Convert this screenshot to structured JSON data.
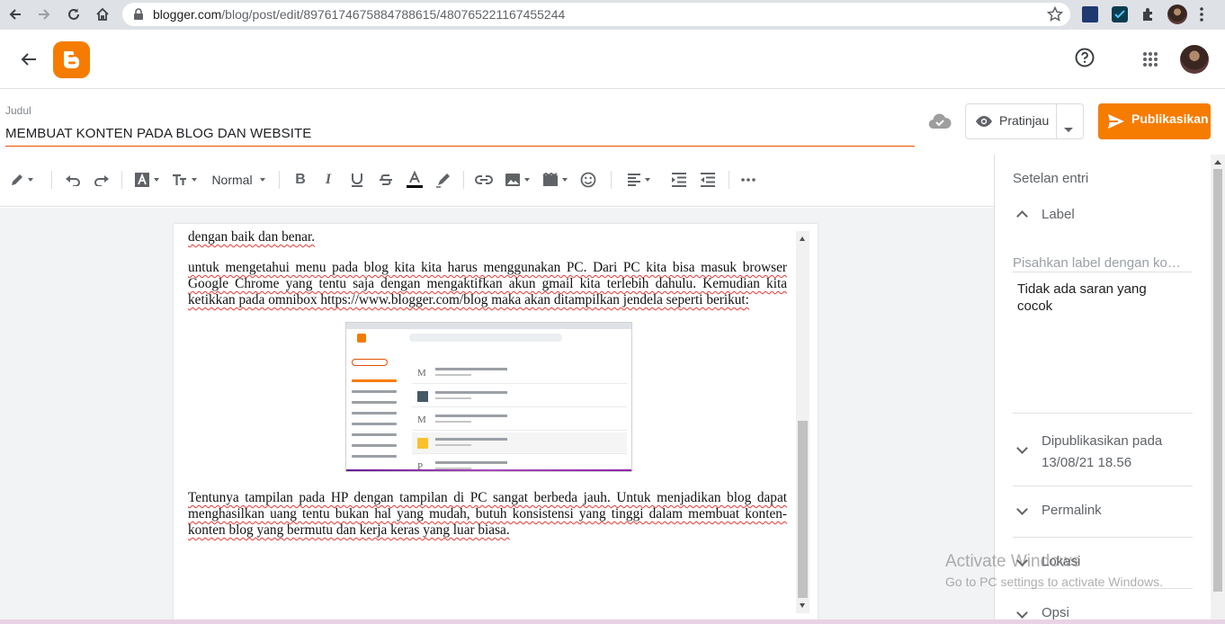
{
  "browser": {
    "url_host": "blogger.com",
    "url_path": "/blog/post/edit/8976174675884788615/480765221167455244"
  },
  "header": {
    "help_icon": "help-circle-icon",
    "apps_icon": "apps-grid-icon"
  },
  "post": {
    "title_label": "Judul",
    "title": "MEMBUAT KONTEN PADA BLOG DAN WEBSITE",
    "preview_label": "Pratinjau",
    "publish_label": "Publikasikan"
  },
  "toolbar": {
    "font_size": "Normal"
  },
  "content": {
    "p1": "dengan baik dan benar.",
    "p2": "untuk mengetahui menu pada blog kita kita harus menggunakan PC. Dari PC kita bisa masuk browser Google Chrome yang tentu saja dengan mengaktifkan akun gmail kita terlebih dahulu. Kemudian kita ketikkan pada omnibox https://www.blogger.com/blog maka akan ditampilkan jendela seperti berikut:",
    "p3": "Tentunya tampilan pada HP dengan tampilan di PC sangat berbeda jauh. Untuk menjadikan blog dapat menghasilkan uang tentu bukan hal yang mudah, butuh konsistensi yang tinggi dalam membuat konten-konten blog yang bermutu dan kerja keras yang luar biasa."
  },
  "panel": {
    "heading": "Setelan entri",
    "label_section": "Label",
    "label_placeholder": "Pisahkan label dengan ko…",
    "label_hint": "Tidak ada saran yang cocok",
    "published_title": "Dipublikasikan pada",
    "published_date": "13/08/21 18.56",
    "permalink": "Permalink",
    "location": "Lokasi",
    "options": "Opsi"
  },
  "watermark": {
    "line1": "Activate Windows",
    "line2": "Go to PC settings to activate Windows."
  },
  "colors": {
    "accent": "#f57c00",
    "title_underline": "#e65100"
  }
}
